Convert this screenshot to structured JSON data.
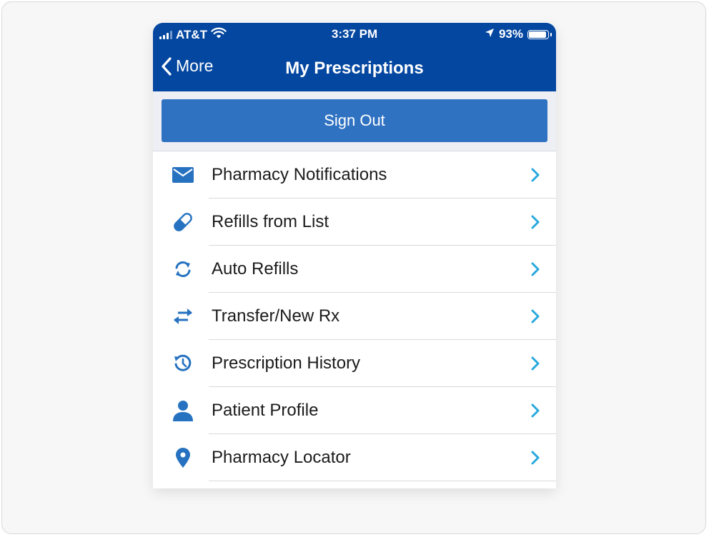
{
  "status_bar": {
    "carrier": "AT&T",
    "time": "3:37 PM",
    "battery_percent": "93%",
    "battery_level": 0.93,
    "icons": [
      "signal-icon",
      "wifi-icon",
      "location-arrow-icon",
      "battery-icon"
    ]
  },
  "nav": {
    "back_label": "More",
    "title": "My Prescriptions"
  },
  "sign_out_label": "Sign Out",
  "menu": [
    {
      "label": "Pharmacy Notifications",
      "icon": "envelope-icon"
    },
    {
      "label": "Refills from List",
      "icon": "pill-icon"
    },
    {
      "label": "Auto Refills",
      "icon": "refresh-icon"
    },
    {
      "label": "Transfer/New Rx",
      "icon": "transfer-arrows-icon"
    },
    {
      "label": "Prescription History",
      "icon": "history-clock-icon"
    },
    {
      "label": "Patient Profile",
      "icon": "person-icon"
    },
    {
      "label": "Pharmacy Locator",
      "icon": "map-pin-icon"
    }
  ],
  "colors": {
    "header_bg": "#0447a0",
    "button_bg": "#3072c2",
    "icon_blue": "#2672c0",
    "chevron": "#27a8dd"
  }
}
